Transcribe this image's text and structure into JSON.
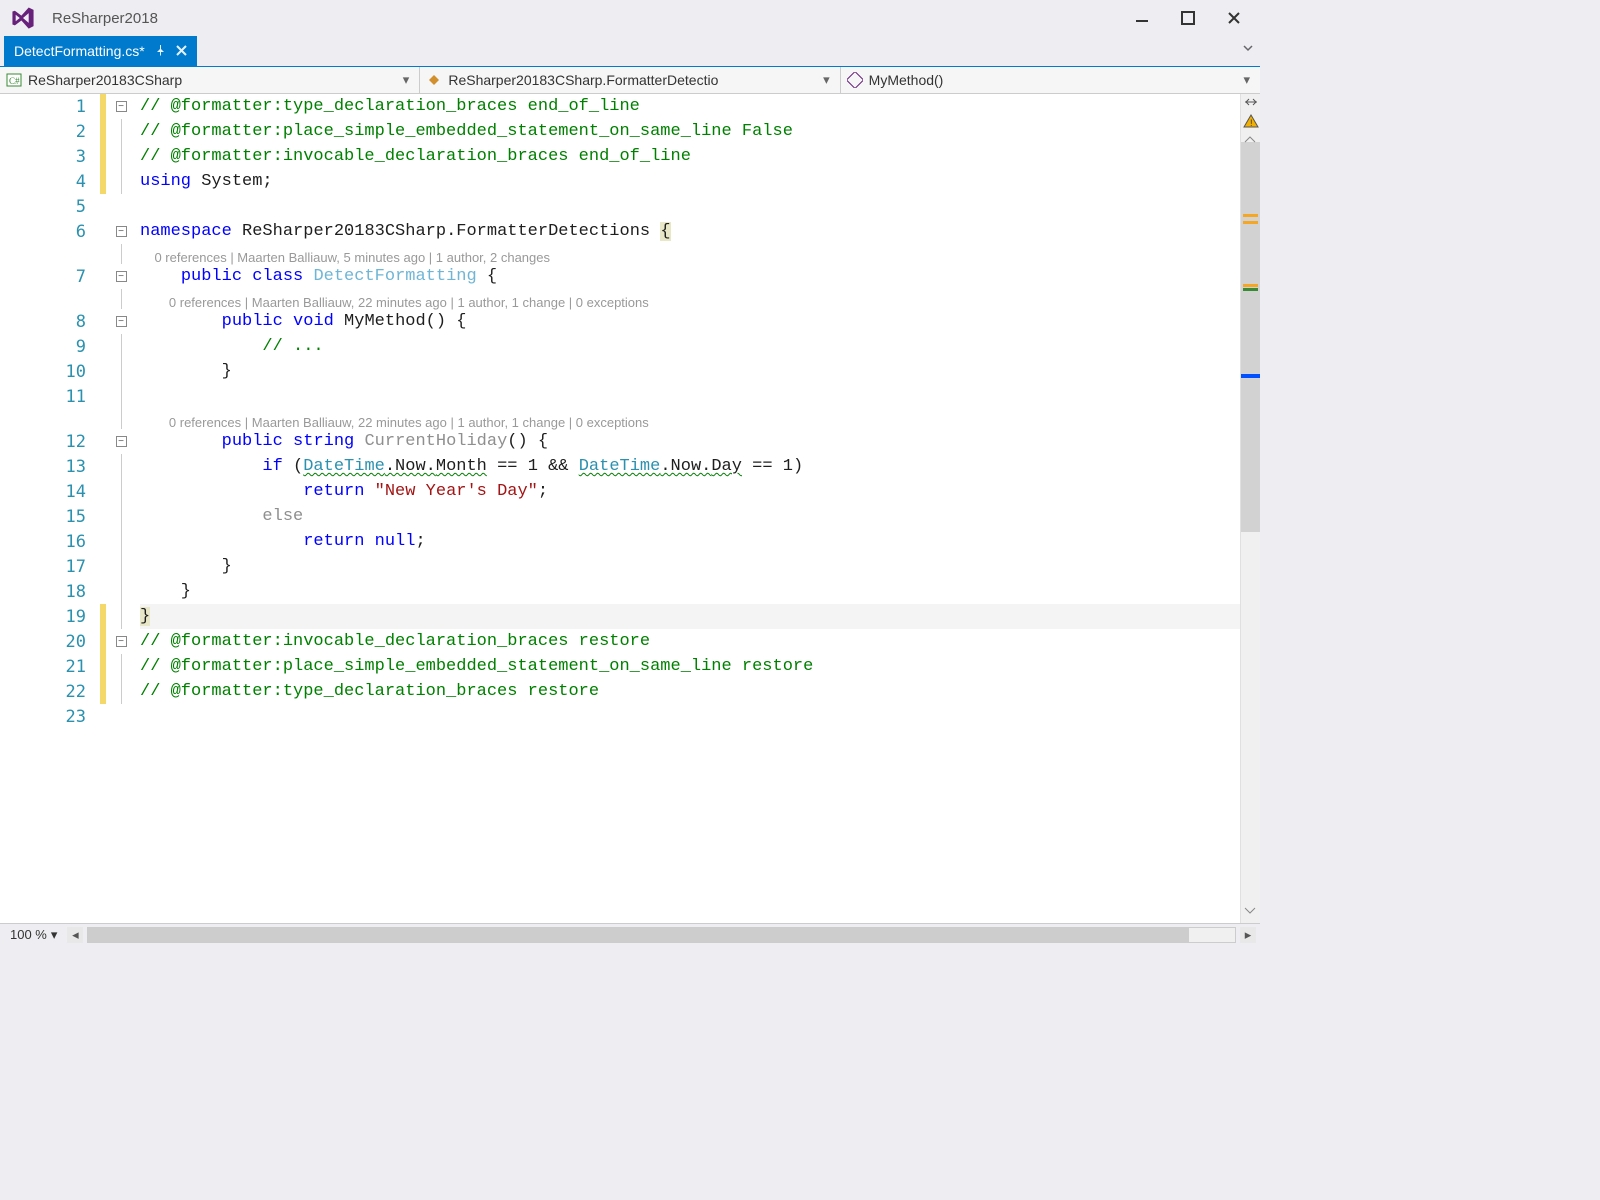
{
  "window": {
    "title": "ReSharper2018"
  },
  "tab": {
    "filename": "DetectFormatting.cs*",
    "modified": true
  },
  "nav": {
    "project": "ReSharper20183CSharp",
    "type": "ReSharper20183CSharp.FormatterDetectio",
    "member": "MyMethod()"
  },
  "gutter": {
    "line_numbers": [
      1,
      2,
      3,
      4,
      5,
      6,
      7,
      8,
      9,
      10,
      11,
      12,
      13,
      14,
      15,
      16,
      17,
      18,
      19,
      20,
      21,
      22,
      23
    ],
    "changed": [
      1,
      2,
      3,
      4,
      19,
      20,
      21,
      22
    ],
    "fold_boxes": [
      1,
      6,
      7,
      8,
      12,
      20
    ],
    "structure_lines": [
      2,
      3,
      4,
      9,
      10,
      11,
      13,
      14,
      15,
      16,
      17,
      18,
      19,
      21,
      22
    ]
  },
  "codelens": {
    "l6": "0 references | Maarten Balliauw, 5 minutes ago | 1 author, 2 changes",
    "l7": "0 references | Maarten Balliauw, 22 minutes ago | 1 author, 1 change | 0 exceptions",
    "l12": "0 references | Maarten Balliauw, 22 minutes ago | 1 author, 1 change | 0 exceptions"
  },
  "code": {
    "l1": "// @formatter:type_declaration_braces end_of_line",
    "l2": "// @formatter:place_simple_embedded_statement_on_same_line False",
    "l3": "// @formatter:invocable_declaration_braces end_of_line",
    "l4a": "using",
    "l4b": " System;",
    "l6a": "namespace",
    "l6b": " ReSharper20183CSharp.FormatterDetections ",
    "l6c": "{",
    "l7a": "    ",
    "l7b": "public",
    "l7c": " ",
    "l7d": "class",
    "l7e": " ",
    "l7f": "DetectFormatting",
    "l7g": " {",
    "l8a": "        ",
    "l8b": "public",
    "l8c": " ",
    "l8d": "void",
    "l8e": " MyMethod() {",
    "l9": "            // ...",
    "l10": "        }",
    "l12a": "        ",
    "l12b": "public",
    "l12c": " ",
    "l12d": "string",
    "l12e": " ",
    "l12f": "CurrentHoliday",
    "l12g": "() {",
    "l13a": "            ",
    "l13b": "if",
    "l13c": " (",
    "l13d": "DateTime",
    "l13e": ".Now.",
    "l13f": "Month",
    "l13g": " == 1 && ",
    "l13h": "DateTime",
    "l13i": ".Now.",
    "l13j": "Day",
    "l13k": " == 1)",
    "l14a": "                ",
    "l14b": "return",
    "l14c": " ",
    "l14d": "\"New Year's Day\"",
    "l14e": ";",
    "l15a": "            ",
    "l15b": "else",
    "l16a": "                ",
    "l16b": "return",
    "l16c": " ",
    "l16d": "null",
    "l16e": ";",
    "l17": "        }",
    "l18": "    }",
    "l19": "}",
    "l20": "// @formatter:invocable_declaration_braces restore",
    "l21": "// @formatter:place_simple_embedded_statement_on_same_line restore",
    "l22": "// @formatter:type_declaration_braces restore"
  },
  "status": {
    "zoom": "100 %"
  },
  "colors": {
    "accent": "#007acc",
    "keyword": "#0000ff",
    "comment": "#008000",
    "type": "#2b91af",
    "string": "#a31515"
  }
}
